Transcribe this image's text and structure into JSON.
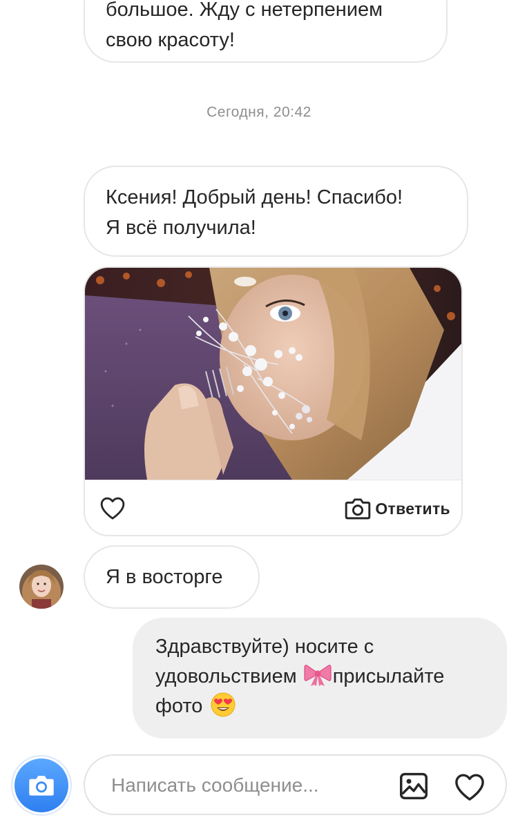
{
  "messages": {
    "top_partial": "большое. Жду с нетерпением\nсвою красоту!",
    "timestamp": "Сегодня, 20:42",
    "greeting": "Ксения! Добрый день! Спасибо!\nЯ всё получила!",
    "story_reply": {
      "reply_label": "Ответить",
      "like_icon": "heart-outline-icon",
      "reply_icon": "camera-outline-icon"
    },
    "delight": "Я в восторге",
    "my_reply": {
      "line1": "Здравствуйте) носите с",
      "line2_part1": "удовольствием ",
      "ribbon_emoji": "ribbon-emoji",
      "line2_part2": "присылайте",
      "line3": "фото ",
      "heart_eyes_emoji": "heart-eyes-emoji"
    }
  },
  "composer": {
    "placeholder": "Написать сообщение...",
    "camera_icon": "camera-icon",
    "gallery_icon": "gallery-icon",
    "like_icon": "heart-outline-icon"
  },
  "colors": {
    "camera_blue": "#3b8cf5",
    "my_bubble_bg": "#efefef",
    "border": "#e6e6e6",
    "timestamp_gray": "#8e8e8e"
  }
}
